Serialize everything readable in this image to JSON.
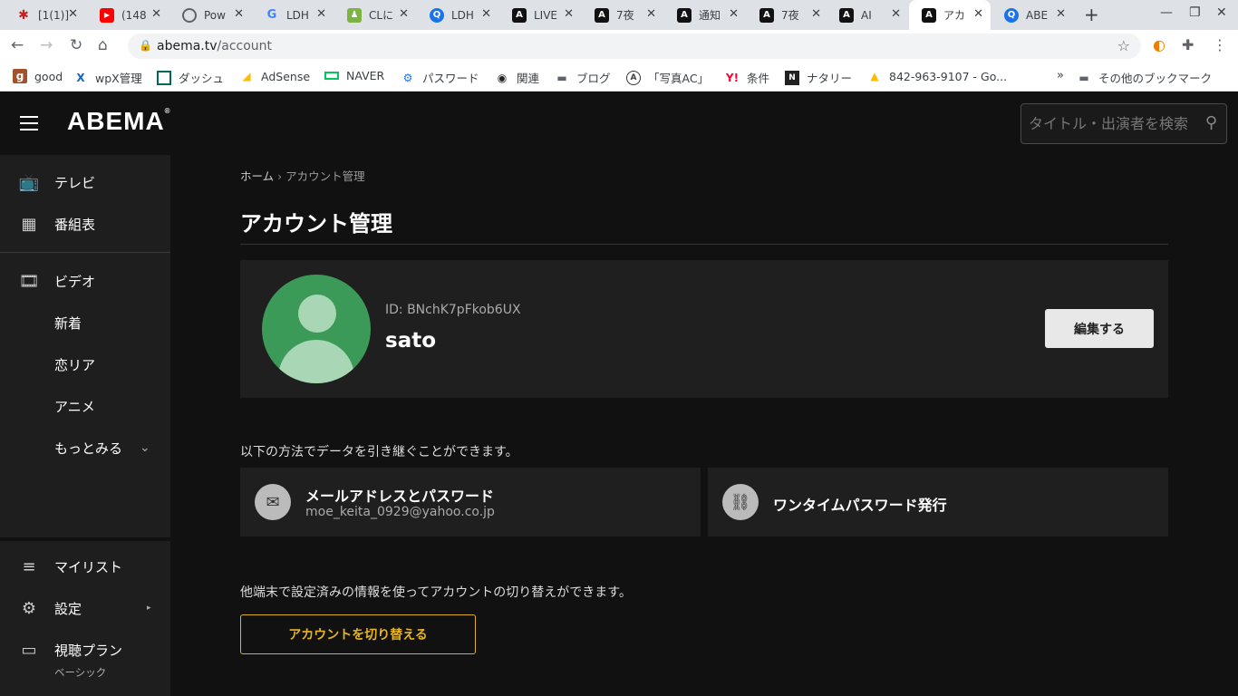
{
  "browser": {
    "tabs": [
      {
        "title": "[1(1)]",
        "icon": "asterisk-icon",
        "color": "#c5221f"
      },
      {
        "title": "(148",
        "icon": "youtube-icon",
        "color": "#ff0000"
      },
      {
        "title": "Pow",
        "icon": "globe-icon",
        "color": "#5f6368"
      },
      {
        "title": "LDH",
        "icon": "google-icon",
        "color": "#4285f4"
      },
      {
        "title": "CLに",
        "icon": "lock-badge-icon",
        "color": "#2e7d32"
      },
      {
        "title": "LDH",
        "icon": "q-icon",
        "color": "#1a73e8"
      },
      {
        "title": "LIVE",
        "icon": "abema-icon",
        "color": "#111111"
      },
      {
        "title": "7夜",
        "icon": "abema-icon",
        "color": "#111111"
      },
      {
        "title": "通知",
        "icon": "abema-icon",
        "color": "#111111"
      },
      {
        "title": "7夜",
        "icon": "abema-icon",
        "color": "#111111"
      },
      {
        "title": "AI",
        "icon": "abema-icon",
        "color": "#111111"
      },
      {
        "title": "アカ",
        "icon": "abema-icon",
        "color": "#111111",
        "active": true
      },
      {
        "title": "ABE",
        "icon": "q-icon",
        "color": "#1a73e8"
      }
    ],
    "url_domain": "abema.tv",
    "url_path": "/account",
    "bookmarks": [
      {
        "label": "good",
        "icon": "g-icon"
      },
      {
        "label": "wpX管理",
        "icon": "x-icon"
      },
      {
        "label": "ダッシュ",
        "icon": "square-icon"
      },
      {
        "label": "AdSense",
        "icon": "adsense-icon"
      },
      {
        "label": "NAVER",
        "icon": "naver-icon"
      },
      {
        "label": "パスワード",
        "icon": "gear-icon"
      },
      {
        "label": "関連",
        "icon": "eye-icon"
      },
      {
        "label": "ブログ",
        "icon": "folder-icon"
      },
      {
        "label": "「写真AC」",
        "icon": "ac-icon"
      },
      {
        "label": "条件",
        "icon": "yahoo-icon"
      },
      {
        "label": "ナタリー",
        "icon": "natalie-icon"
      },
      {
        "label": "842-963-9107 - Go...",
        "icon": "ads-icon"
      }
    ],
    "other_bookmarks": "その他のブックマーク"
  },
  "header": {
    "logo": "ABEMA",
    "search_placeholder": "タイトル・出演者を検索"
  },
  "sidebar": {
    "items": [
      {
        "label": "テレビ",
        "icon": "tv-icon"
      },
      {
        "label": "番組表",
        "icon": "calendar-icon"
      },
      {
        "label": "ビデオ",
        "icon": "film-icon"
      },
      {
        "label": "新着"
      },
      {
        "label": "恋リア"
      },
      {
        "label": "アニメ"
      },
      {
        "label": "もっとみる",
        "icon": "chevron-down-icon"
      },
      {
        "label": "マイリスト",
        "icon": "list-icon"
      },
      {
        "label": "設定",
        "icon": "gear-icon"
      },
      {
        "label": "視聴プラン",
        "icon": "card-icon",
        "sub": "ベーシック"
      }
    ]
  },
  "main": {
    "breadcrumb": {
      "home": "ホーム",
      "current": "アカウント管理"
    },
    "title": "アカウント管理",
    "profile": {
      "id": "ID: BNchK7pFkob6UX",
      "name": "sato",
      "edit_label": "編集する"
    },
    "carry_over_text": "以下の方法でデータを引き継ぐことができます。",
    "methods": [
      {
        "title": "メールアドレスとパスワード",
        "sub": "moe_keita_0929@yahoo.co.jp",
        "icon": "mail-icon"
      },
      {
        "title": "ワンタイムパスワード発行",
        "icon": "link-icon"
      }
    ],
    "switch_text": "他端末で設定済みの情報を使ってアカウントの切り替えができます。",
    "switch_label": "アカウントを切り替える"
  },
  "colors": {
    "accent": "#e6b422",
    "avatar": "#3b9a57"
  }
}
